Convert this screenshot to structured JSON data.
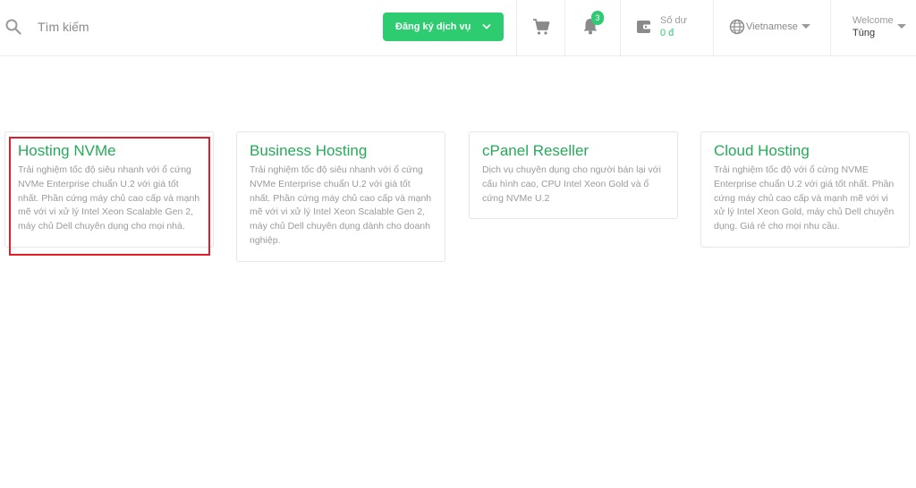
{
  "header": {
    "search": {
      "placeholder": "Tìm kiếm",
      "icon": "search-icon"
    },
    "register_button": {
      "label": "Đăng ký dịch vụ",
      "icon": "chevron-down-icon"
    },
    "cart": {
      "icon": "cart-icon"
    },
    "notifications": {
      "icon": "bell-icon",
      "count": "3"
    },
    "balance": {
      "icon": "wallet-icon",
      "label": "Số dư",
      "value": "0 đ"
    },
    "language": {
      "icon": "globe-icon",
      "selected": "Vietnamese"
    },
    "user": {
      "welcome": "Welcome",
      "name": "Tùng"
    }
  },
  "colors": {
    "accent": "#2ecc71",
    "title_green": "#27a95a",
    "highlight": "#e21d2a"
  },
  "cards": [
    {
      "title": "Hosting NVMe",
      "description": "Trải nghiệm tốc độ siêu nhanh với ổ cứng NVMe Enterprise chuẩn U.2 với giá tốt nhất. Phần cứng máy chủ cao cấp và mạnh mẽ với vi xử lý Intel Xeon Scalable Gen 2, máy chủ Dell chuyên dụng cho mọi nhà."
    },
    {
      "title": "Business Hosting",
      "description": "Trải nghiệm tốc độ siêu nhanh với ổ cứng NVMe Enterprise chuẩn U.2 với giá tốt nhất. Phần cứng máy chủ cao cấp và mạnh mẽ với vi xử lý Intel Xeon Scalable Gen 2, máy chủ Dell chuyên dụng dành cho doanh nghiệp."
    },
    {
      "title": "cPanel Reseller",
      "description": "Dịch vụ chuyên dụng cho người bán lại với cấu hình cao, CPU Intel Xeon Gold và ổ cứng NVMe U.2"
    },
    {
      "title": "Cloud Hosting",
      "description": "Trải nghiệm tốc độ với ổ cứng NVME Enterprise chuẩn U.2 với giá tốt nhất. Phần cứng máy chủ cao cấp và mạnh mẽ với vi xử lý Intel Xeon Gold, máy chủ Dell chuyên dụng. Giá rẻ cho mọi nhu cầu."
    }
  ]
}
